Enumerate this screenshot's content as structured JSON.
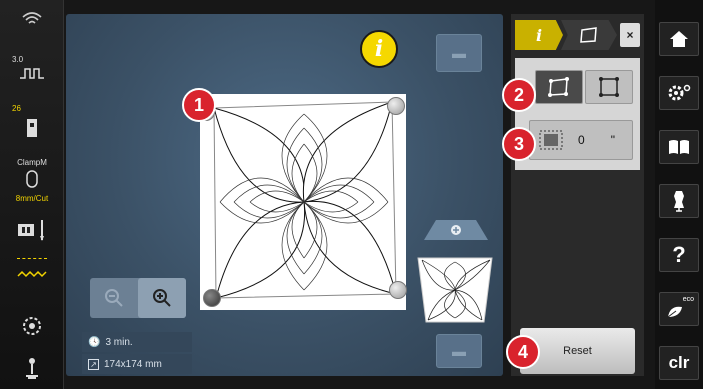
{
  "left_bar": {
    "needle_size": "3.0",
    "thread_count": "26",
    "clamp_label": "ClampM",
    "cut_label": "8mm/Cut"
  },
  "canvas": {
    "markers": [
      "1",
      "2",
      "3",
      "4"
    ],
    "time": "3 min.",
    "size": "174x174 mm"
  },
  "panel": {
    "value": "0",
    "unit": "\"",
    "reset_label": "Reset"
  },
  "right_bar": {
    "clr_label": "clr",
    "eco_label": "eco",
    "help_label": "?"
  }
}
